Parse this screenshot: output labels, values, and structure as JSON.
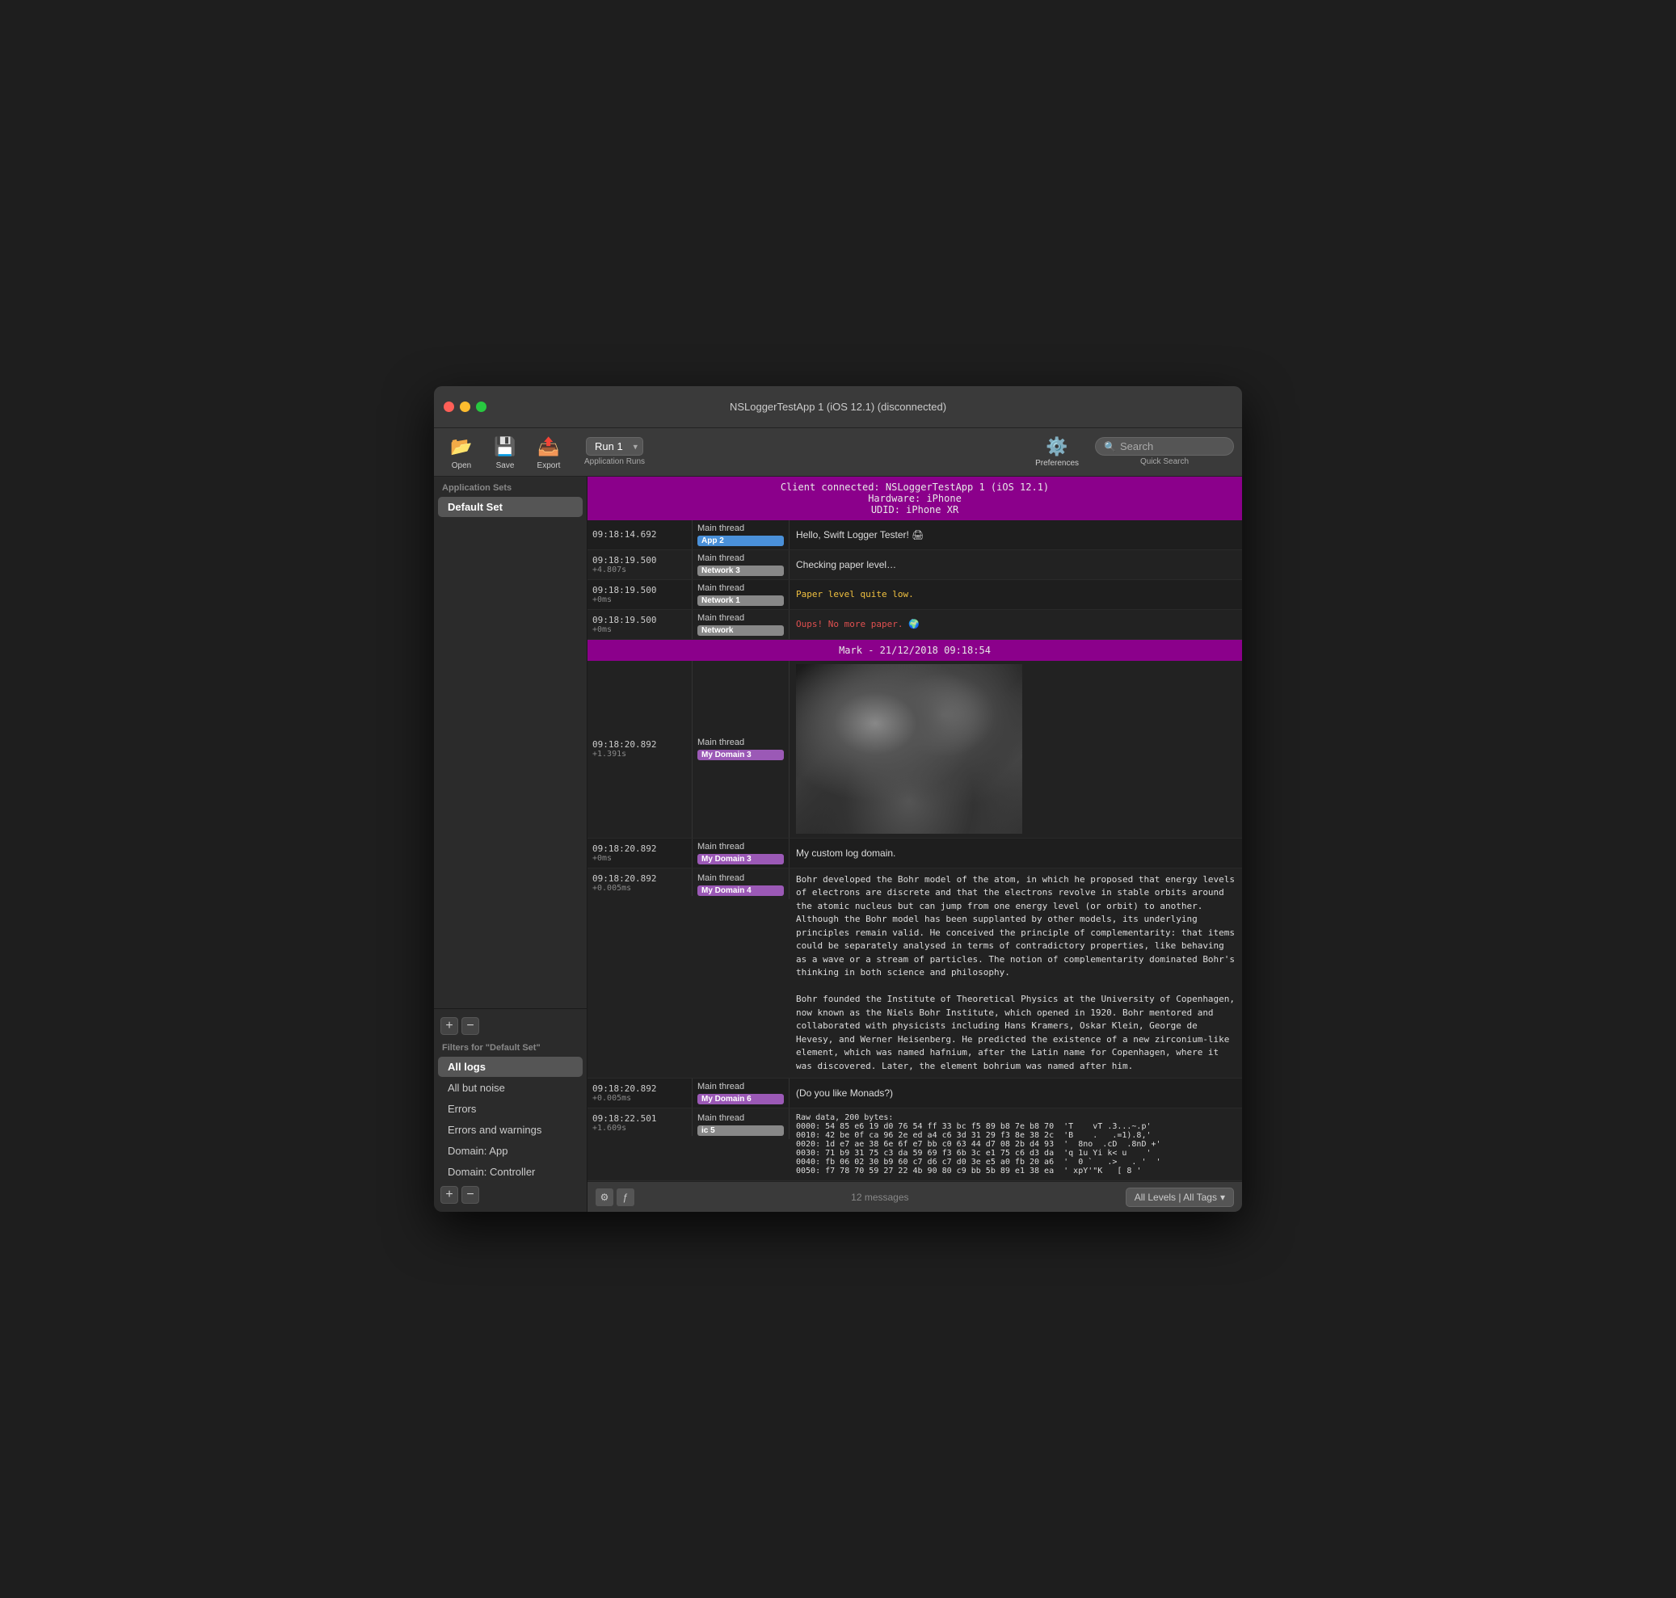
{
  "window": {
    "title": "NSLoggerTestApp 1 (iOS 12.1) (disconnected)"
  },
  "toolbar": {
    "open_label": "Open",
    "save_label": "Save",
    "export_label": "Export",
    "run_label": "Run 1",
    "app_runs_label": "Application Runs",
    "preferences_label": "Preferences",
    "quick_search_label": "Quick Search",
    "search_placeholder": "Search"
  },
  "sidebar": {
    "app_sets_title": "Application Sets",
    "default_set": "Default Set",
    "filters_title": "Filters for \"Default Set\"",
    "filters": [
      {
        "label": "All logs",
        "active": true
      },
      {
        "label": "All but noise"
      },
      {
        "label": "Errors"
      },
      {
        "label": "Errors and warnings"
      },
      {
        "label": "Domain: App"
      },
      {
        "label": "Domain: Controller"
      }
    ]
  },
  "banner1": {
    "line1": "Client connected: NSLoggerTestApp 1 (iOS 12.1)",
    "line2": "Hardware: iPhone",
    "line3": "UDID: iPhone XR"
  },
  "banner2": {
    "text": "Mark - 21/12/2018 09:18:54"
  },
  "logs": [
    {
      "time": "09:18:14.692",
      "delta": "",
      "thread": "Main thread",
      "tag": "App",
      "tag_class": "tag-app",
      "tag_num": "2",
      "content": "Hello, Swift Logger Tester! 🖨",
      "type": "text"
    },
    {
      "time": "09:18:19.500",
      "delta": "+4.807s",
      "thread": "Main thread",
      "tag": "Network",
      "tag_class": "tag-network",
      "tag_num": "3",
      "content": "Checking paper level…",
      "type": "text"
    },
    {
      "time": "09:18:19.500",
      "delta": "+0ms",
      "thread": "Main thread",
      "tag": "Network",
      "tag_class": "tag-network",
      "tag_num": "1",
      "content": "Paper level quite low.",
      "type": "text",
      "text_class": "text-yellow"
    },
    {
      "time": "09:18:19.500",
      "delta": "+0ms",
      "thread": "Main thread",
      "tag": "Network",
      "tag_class": "tag-network",
      "tag_num": "",
      "content": "Oups! No more paper. 🌍",
      "type": "text",
      "text_class": "text-red"
    },
    {
      "time": "09:18:20.892",
      "delta": "+1.391s",
      "thread": "Main thread",
      "tag": "My Domain",
      "tag_class": "tag-mydomain",
      "tag_num": "3",
      "content": "",
      "type": "image"
    },
    {
      "time": "09:18:20.892",
      "delta": "+0ms",
      "thread": "Main thread",
      "tag": "My Domain",
      "tag_class": "tag-mydomain",
      "tag_num": "3",
      "content": "My custom log domain.",
      "type": "text"
    },
    {
      "time": "09:18:20.892",
      "delta": "+0.005ms",
      "thread": "Main thread",
      "tag": "My Domain",
      "tag_class": "tag-mydomain",
      "tag_num": "4",
      "content": "Bohr developed the Bohr model of the atom, in which he proposed that energy levels of electrons are discrete and that the electrons revolve in stable orbits around the atomic nucleus but can jump from one energy level (or orbit) to another. Although the Bohr model has been supplanted by other models, its underlying principles remain valid. He conceived the principle of complementarity: that items could be separately analysed in terms of contradictory properties, like behaving as a wave or a stream of particles. The notion of complementarity dominated Bohr's thinking in both science and philosophy.\n\nBohr founded the Institute of Theoretical Physics at the University of Copenhagen, now known as the Niels Bohr Institute, which opened in 1920. Bohr mentored and collaborated with physicists including Hans Kramers, Oskar Klein, George de Hevesy, and Werner Heisenberg. He predicted the existence of a new zirconium-like element, which was named hafnium, after the Latin name for Copenhagen, where it was discovered. Later, the element bohrium was named after him.",
      "type": "longtext"
    },
    {
      "time": "09:18:20.892",
      "delta": "+0.005ms",
      "thread": "Main thread",
      "tag": "My Domain",
      "tag_class": "tag-mydomain",
      "tag_num": "6",
      "content": "(Do you like Monads?)",
      "type": "text"
    },
    {
      "time": "09:18:22.501",
      "delta": "+1.609s",
      "thread": "Main thread",
      "tag": "ic",
      "tag_class": "tag-ic",
      "tag_num": "5",
      "content": "Raw data, 200 bytes:\n0000: 54 85 e6 19 d0 76 54 ff 33 bc f5 89 b8 7e b8 70  'T    vT .3...~.p'\n0010: 42 be 0f ca 96 2e ed a4 c6 3d 31 29 f3 8e 38 2c  'B    .   .=1).8,'\n0020: 1d e7 ae 38 6e 6f e7 bb c0 63 44 d7 08 2b d4 93  '  8no  .cD  .8nD +'\n0030: 71 b9 31 75 c3 da 59 69 f3 6b 3c e1 75 c6 d3 da  'q 1u Yi k< u    '\n0040: fb 06 02 30 b9 60 c7 d6 c7 d0 3e e5 a0 fb 20 a6  '  0 `   .>   . '  '\n0050: f7 78 70 59 27 22 4b 90 80 c9 bb 5b 89 e1 38 ea  ' xpY'\"K   [ 8 '",
      "type": "hex"
    }
  ],
  "status_bar": {
    "msg_count": "12 messages",
    "level_tags": "All Levels | All Tags"
  }
}
